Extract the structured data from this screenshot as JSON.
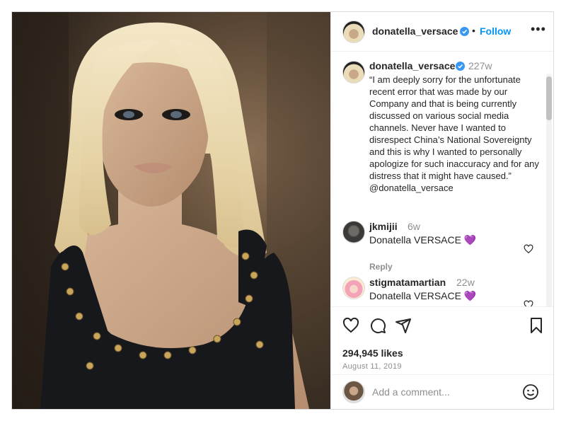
{
  "colors": {
    "link": "#0095f6",
    "verified": "#3897f0",
    "heart_purple": "#9b4dca",
    "secondary_text": "#8e8e8e"
  },
  "header": {
    "username": "donatella_versace",
    "separator": "•",
    "follow_label": "Follow",
    "more_icon": "more-horizontal-icon",
    "more_label": "•••"
  },
  "caption": {
    "username": "donatella_versace",
    "time": "227w",
    "text": "“I am deeply sorry for the unfortunate recent error that was made by our Company and that is being currently discussed on various social media channels. Never have I wanted to disrespect China’s National Sovereignty and this is why I wanted to personally apologize for such inaccuracy and for any distress that it might have caused.” @donatella_versace"
  },
  "comments": [
    {
      "username": "jkmijii",
      "time": "6w",
      "text": "Donatella VERSACE 💜",
      "reply_label": "Reply"
    },
    {
      "username": "stigmatamartian",
      "time": "22w",
      "text": "Donatella VERSACE 💜"
    }
  ],
  "actions": {
    "icons": [
      "heart-icon",
      "comment-icon",
      "share-icon",
      "bookmark-icon"
    ],
    "likes": "294,945 likes",
    "date": "August 11, 2019"
  },
  "add_comment": {
    "placeholder": "Add a comment...",
    "emoji_icon": "smiley-icon"
  }
}
